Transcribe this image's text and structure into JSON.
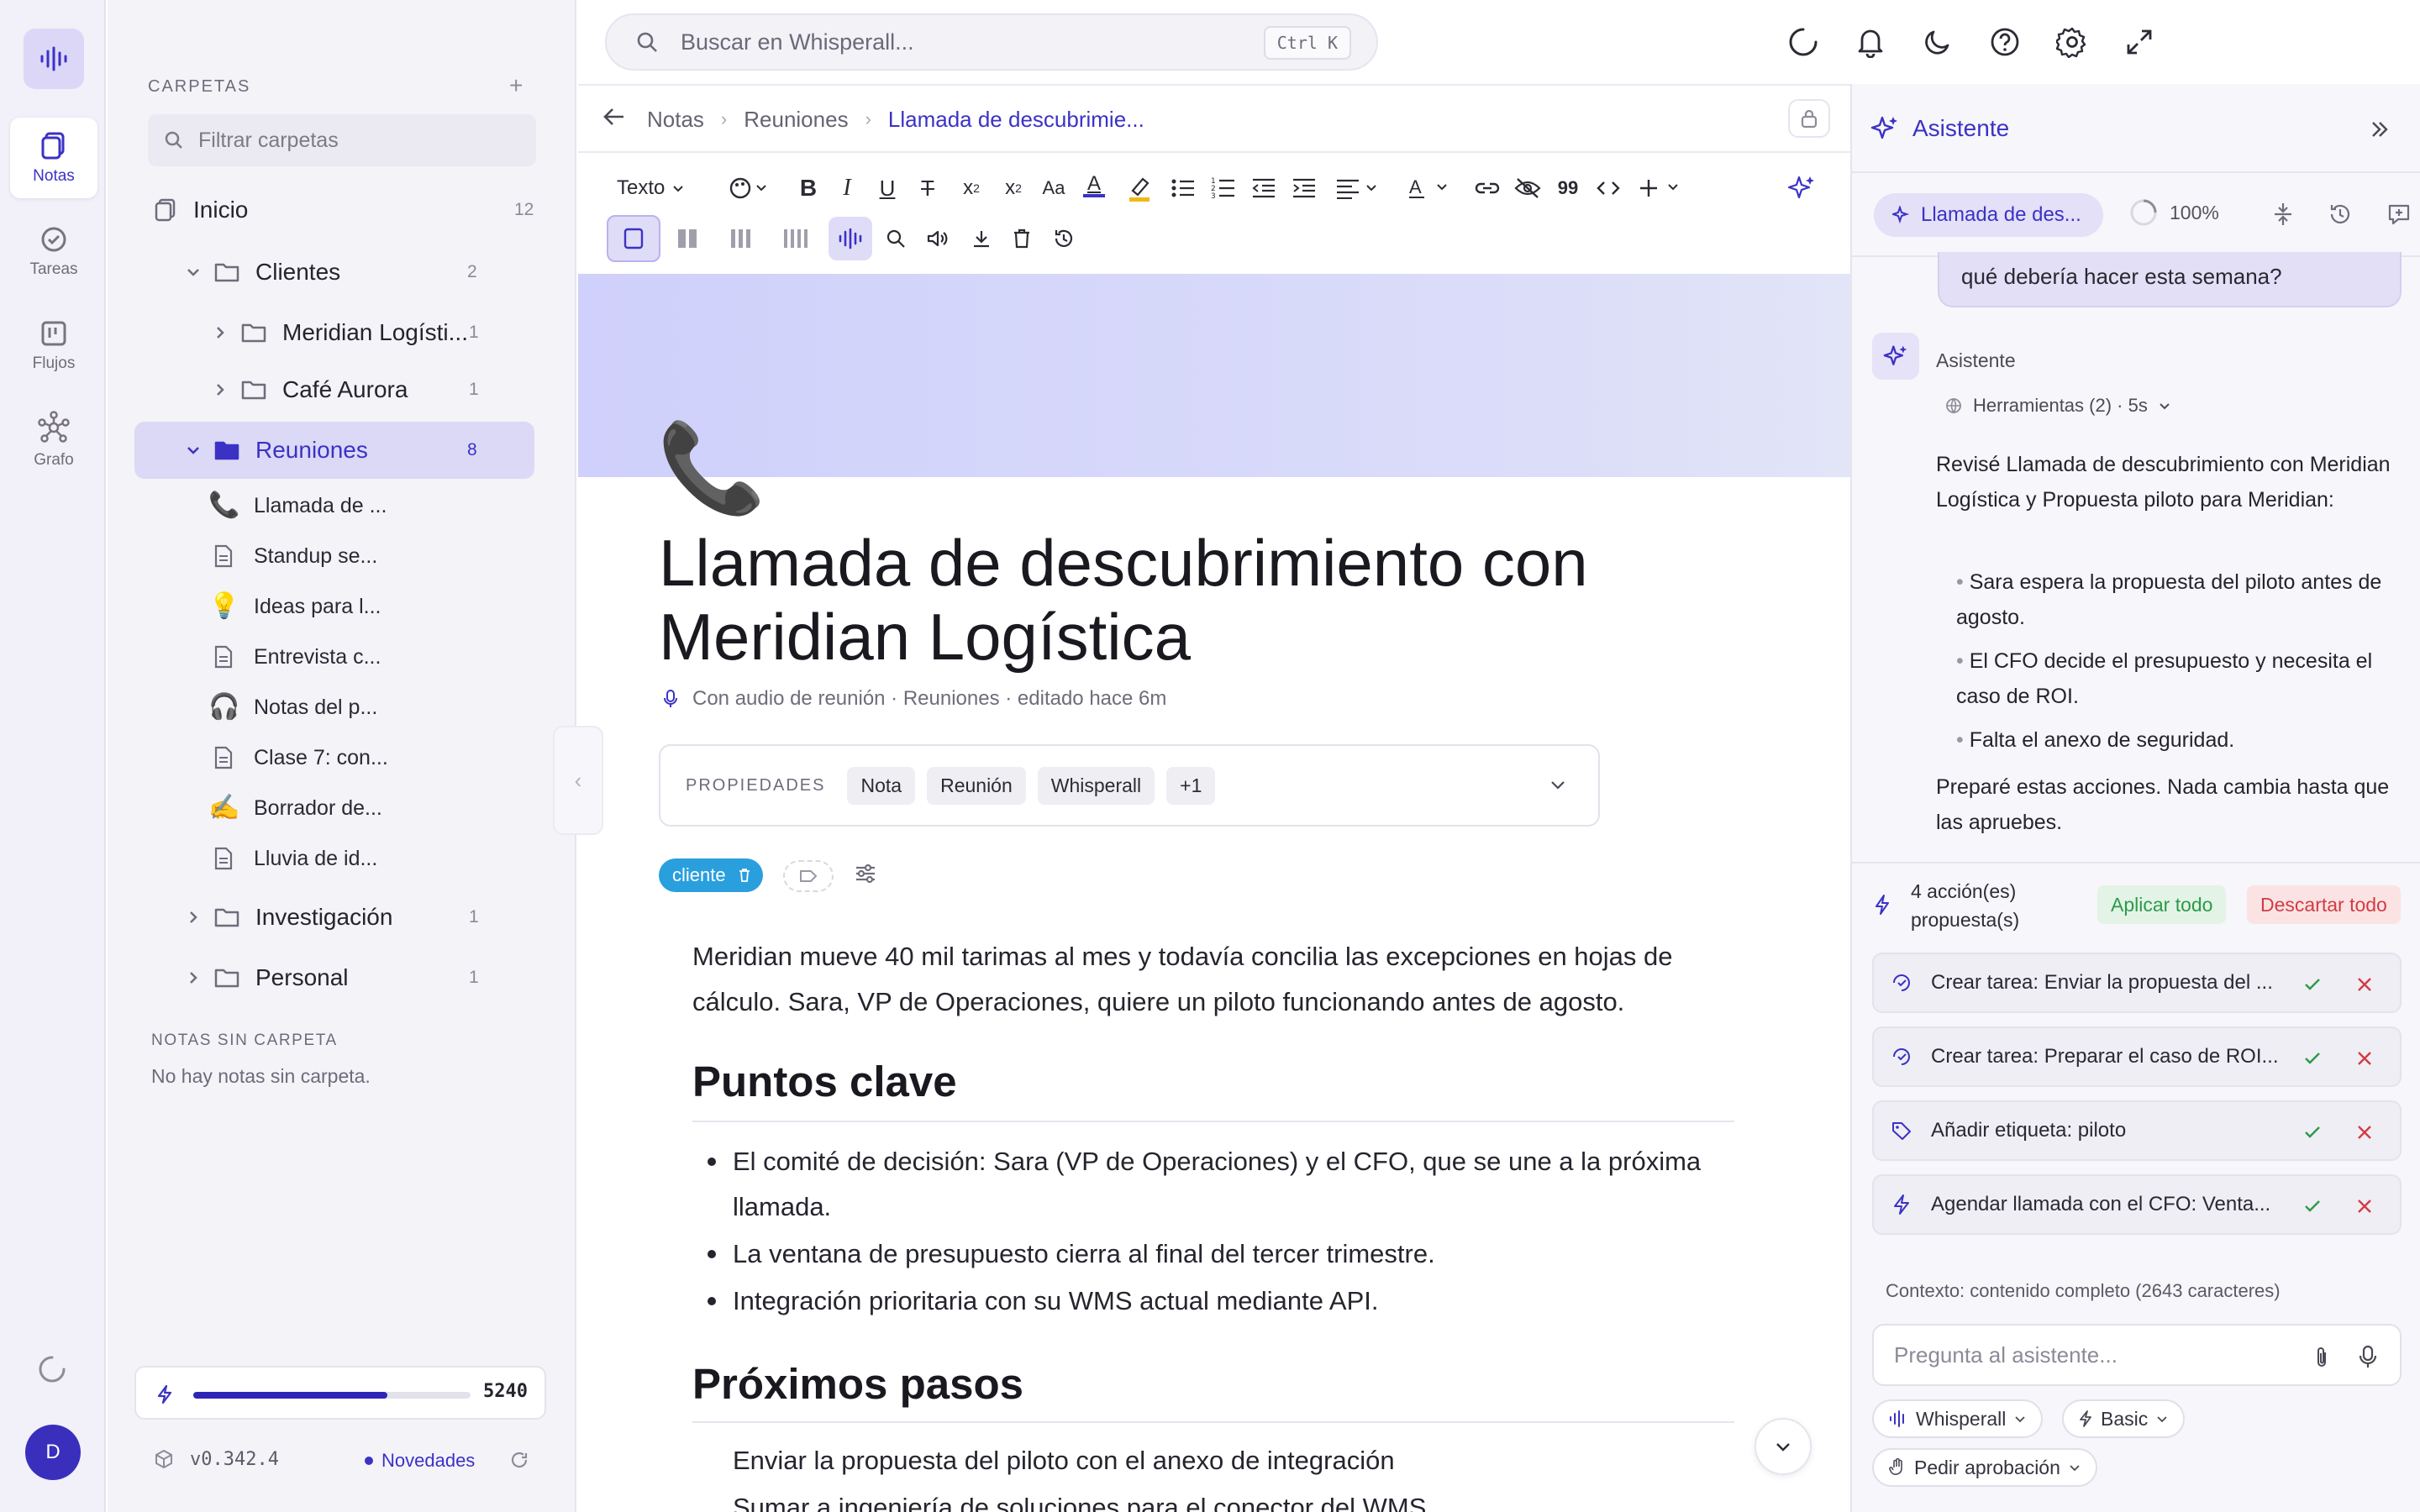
{
  "rail": {
    "items": [
      {
        "label": "Notas",
        "icon": "notes-icon"
      },
      {
        "label": "Tareas",
        "icon": "tasks-icon"
      },
      {
        "label": "Flujos",
        "icon": "flows-icon"
      },
      {
        "label": "Grafo",
        "icon": "graph-icon"
      }
    ],
    "avatar_initial": "D"
  },
  "sidebar": {
    "heading": "CARPETAS",
    "add_label": "+",
    "filter_placeholder": "Filtrar carpetas",
    "tree": {
      "inicio": {
        "label": "Inicio",
        "count": "12"
      },
      "clientes": {
        "label": "Clientes",
        "count": "2"
      },
      "meridian": {
        "label": "Meridian Logísti...",
        "count": "1"
      },
      "cafe": {
        "label": "Café Aurora",
        "count": "1"
      },
      "reuniones": {
        "label": "Reuniones",
        "count": "8"
      },
      "investigacion": {
        "label": "Investigación",
        "count": "1"
      },
      "personal": {
        "label": "Personal",
        "count": "1"
      }
    },
    "notes": [
      {
        "emoji": "📞",
        "label": "Llamada de ..."
      },
      {
        "emoji": "",
        "label": "Standup se..."
      },
      {
        "emoji": "💡",
        "label": "Ideas para l..."
      },
      {
        "emoji": "",
        "label": "Entrevista c..."
      },
      {
        "emoji": "🎧",
        "label": "Notas del p..."
      },
      {
        "emoji": "",
        "label": "Clase 7: con..."
      },
      {
        "emoji": "✍️",
        "label": "Borrador de..."
      },
      {
        "emoji": "",
        "label": "Lluvia de id..."
      }
    ],
    "unfiled_heading": "NOTAS SIN CARPETA",
    "unfiled_empty": "No hay notas sin carpeta.",
    "credits": {
      "value": "5240",
      "fill_fraction": 0.7
    },
    "version": "v0.342.4",
    "news_label": "Novedades"
  },
  "topbar": {
    "search_placeholder": "Buscar en Whisperall...",
    "shortcut": "Ctrl K"
  },
  "editor": {
    "breadcrumb": [
      "Notas",
      "Reuniones",
      "Llamada de descubrimie..."
    ],
    "toolbar": {
      "text_style": "Texto"
    },
    "emoji": "📞",
    "title": "Llamada de descubrimiento con Meridian Logística",
    "meta": "Con audio de reunión · Reuniones · editado hace 6m",
    "properties": {
      "label": "PROPIEDADES",
      "chips": [
        "Nota",
        "Reunión",
        "Whisperall",
        "+1"
      ]
    },
    "tag": "cliente",
    "intro": "Meridian mueve 40 mil tarimas al mes y todavía concilia las excepciones en hojas de cálculo. Sara, VP de Operaciones, quiere un piloto funcionando antes de agosto.",
    "section1": {
      "heading": "Puntos clave",
      "bullets": [
        "El comité de decisión: Sara (VP de Operaciones) y el CFO, que se une a la próxima llamada.",
        "La ventana de presupuesto cierra al final del tercer trimestre.",
        "Integración prioritaria con su WMS actual mediante API."
      ]
    },
    "section2": {
      "heading": "Próximos pasos",
      "bullets": [
        "Enviar la propuesta del piloto con el anexo de integración",
        "Sumar a ingeniería de soluciones para el conector del WMS"
      ]
    }
  },
  "assistant": {
    "title": "Asistente",
    "context_chip": "Llamada de des...",
    "zoom": "100%",
    "user_message": "qué debería hacer esta semana?",
    "bot_name": "Asistente",
    "tools": "Herramientas (2) · 5s",
    "reply_intro": "Revisé Llamada de descubrimiento con Meridian Logística y Propuesta piloto para Meridian:",
    "reply_bullets": [
      "Sara espera la propuesta del piloto antes de agosto.",
      "El CFO decide el presupuesto y necesita el caso de ROI.",
      "Falta el anexo de seguridad."
    ],
    "reply_outro": "Preparé estas acciones. Nada cambia hasta que las apruebes.",
    "actions_label": "4 acción(es) propuesta(s)",
    "apply_all": "Aplicar todo",
    "discard_all": "Descartar todo",
    "actions": [
      {
        "icon": "task-icon",
        "label": "Crear tarea: Enviar la propuesta del ..."
      },
      {
        "icon": "task-icon",
        "label": "Crear tarea: Preparar el caso de ROI..."
      },
      {
        "icon": "tag-icon",
        "label": "Añadir etiqueta: piloto"
      },
      {
        "icon": "bolt-icon",
        "label": "Agendar llamada con el CFO: Venta..."
      }
    ],
    "context_text": "Contexto: contenido completo (2643 caracteres)",
    "input_placeholder": "Pregunta al asistente...",
    "pills": [
      "Whisperall",
      "Basic",
      "Pedir aprobación"
    ]
  },
  "colors": {
    "accent": "#3b32c5",
    "selection": "#dcd9f6",
    "banner": "#cfd0fb",
    "tag": "#2a9fde",
    "approve": "#2c9a4a",
    "reject": "#d13c43"
  }
}
